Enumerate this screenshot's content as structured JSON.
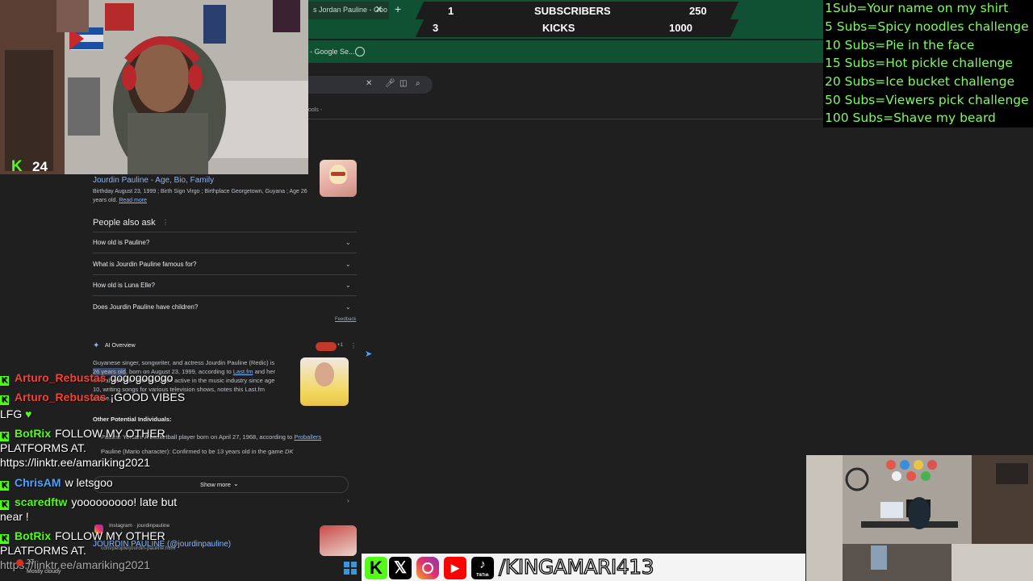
{
  "browser": {
    "active_tab_title": "s Jordan Pauline - Goo",
    "new_tab_symbol": "+",
    "bookmark_label": "- Google Se..."
  },
  "counter": {
    "rows": [
      {
        "current": "1",
        "label": "SUBSCRIBERS",
        "goal": "250"
      },
      {
        "current": "3",
        "label": "KICKS",
        "goal": "1000"
      }
    ]
  },
  "search": {
    "tools_label": "ools -"
  },
  "result": {
    "title": "Jourdin Pauline - Age, Bio, Family",
    "snippet_line1": "Birthday August 23, 1999 ; Birth Sign Virgo ; Birthplace Georgetown, Guyana ; Age 26",
    "snippet_line2": "years old.",
    "read_more": "Read more"
  },
  "people_also_ask": {
    "heading": "People also ask",
    "questions": [
      "How old is Pauline?",
      "What is Jourdin Pauline famous for?",
      "How old is Luna Elle?",
      "Does Jourdin Pauline have children?"
    ],
    "feedback": "Feedback"
  },
  "ai_overview": {
    "heading": "AI Overview",
    "badge_count": "+1",
    "text_line1": "Guyanese singer, songwriter, and actress Jourdin Pauline (Redic) is",
    "text_line2_highlight": "26 years old",
    "text_line2_rest": ", born on August 23, 1999, according to",
    "text_line2_link": "Last.fm",
    "text_line2_end": "and her",
    "text_line3": "official website. She has been active in the music industry since age",
    "text_line4": "10, writing songs for various television shows, notes this Last.fm",
    "text_line5": "article.",
    "other_heading": "Other Potential Individuals:",
    "other_line1": "Pauline Yersan: A basketball player born on April 27, 1968, according to",
    "other_line1_link": "Proballers",
    "other_line2": "Pauline (Mario character): Confirmed to be 13 years old in the game",
    "other_line2_em": "DK",
    "show_more": "Show more"
  },
  "instagram_result": {
    "source": "Instagram · jourdinpauline",
    "title": "JOURDIN PAULINE (@jourdinpauline)",
    "url_fragment": "com/people/jourdin-pauline.html"
  },
  "stream": {
    "kick_count": "24",
    "weather": "Mostly cloudy",
    "temp": "27"
  },
  "chat": [
    {
      "user": "Arturo_Rebustas",
      "user_color": "#f44336",
      "message": "gogogogogo"
    },
    {
      "user": "Arturo_Rebustas",
      "user_color": "#f44336",
      "message": "¡GOOD VIBES"
    },
    {
      "user": "",
      "user_color": "#ffffff",
      "message": "LFG"
    },
    {
      "user": "BotRix",
      "user_color": "#53fc18",
      "message": "FOLLOW MY OTHER"
    },
    {
      "user": "",
      "user_color": "#ffffff",
      "message": "PLATFORMS AT."
    },
    {
      "user": "",
      "user_color": "#ffffff",
      "message": "https://linktr.ee/amariking2021"
    },
    {
      "user": "ChrisAM",
      "user_color": "#4aa3ff",
      "message": "w letsgoo"
    },
    {
      "user": "scaredftw",
      "user_color": "#53fc18",
      "message": "yooooooooo! late but"
    },
    {
      "user": "",
      "user_color": "#ffffff",
      "message": "near !"
    },
    {
      "user": "BotRix",
      "user_color": "#53fc18",
      "message": "FOLLOW MY OTHER"
    },
    {
      "user": "",
      "user_color": "#ffffff",
      "message": "PLATFORMS AT."
    },
    {
      "user": "",
      "user_color": "#ffffff",
      "message": "https://linktr.ee/amariking2021"
    }
  ],
  "goals": [
    "1Sub=Your name on my shirt",
    "5 Subs=Spicy noodles challenge",
    "10 Subs=Pie in the face",
    "15 Subs=Hot pickle challenge",
    "20 Subs=Ice bucket challenge",
    "50 Subs=Viewers pick challenge",
    "100 Subs=Shave my beard"
  ],
  "social": {
    "handle": "/KINGAMARI413",
    "tiktok_label": "TikTok",
    "icons": [
      "kick-icon",
      "x-icon",
      "instagram-icon",
      "youtube-icon",
      "tiktok-icon"
    ]
  },
  "colors": {
    "kick_green": "#53fc18",
    "goal_green": "#7dfc5a",
    "link_blue": "#8ab4f8",
    "tab_green": "#0f5132"
  }
}
